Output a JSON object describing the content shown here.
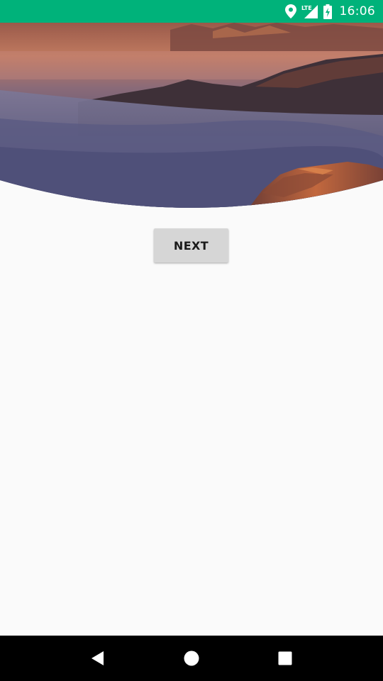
{
  "status_bar": {
    "time": "16:06",
    "network_label": "LTE",
    "icons": [
      "location-icon",
      "lte-signal-icon",
      "battery-charging-icon"
    ],
    "background": "#00b27a"
  },
  "hero": {
    "image": "mountain-sunset-clouds"
  },
  "actions": {
    "next_label": "NEXT"
  },
  "navigation": {
    "buttons": [
      "back-icon",
      "home-icon",
      "recents-icon"
    ]
  }
}
